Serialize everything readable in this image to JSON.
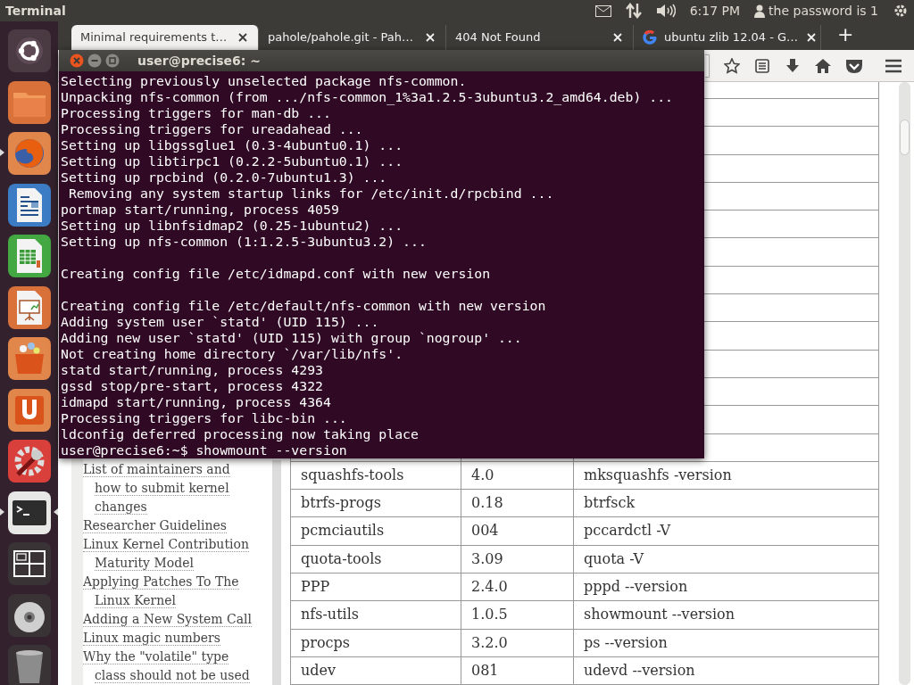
{
  "top_panel": {
    "app_title": "Terminal",
    "clock": "6:17 PM",
    "user": "the password is 1"
  },
  "launcher": [
    {
      "kind": "dash",
      "running": false,
      "focused": false
    },
    {
      "kind": "files",
      "running": false,
      "focused": false
    },
    {
      "kind": "firefox",
      "running": true,
      "focused": false
    },
    {
      "kind": "writer",
      "running": false,
      "focused": false
    },
    {
      "kind": "calc",
      "running": false,
      "focused": false
    },
    {
      "kind": "impress",
      "running": false,
      "focused": false
    },
    {
      "kind": "software",
      "running": false,
      "focused": false
    },
    {
      "kind": "ubuntuone",
      "running": false,
      "focused": false
    },
    {
      "kind": "settings",
      "running": false,
      "focused": false
    },
    {
      "kind": "terminal",
      "running": true,
      "focused": true
    },
    {
      "kind": "workspaces",
      "running": false,
      "focused": false
    },
    {
      "kind": "disc",
      "running": false,
      "focused": false
    },
    {
      "kind": "trash",
      "running": false,
      "focused": false
    }
  ],
  "browser": {
    "tabs": [
      {
        "title": "Minimal requirements t…",
        "selected": true,
        "favicon": false
      },
      {
        "title": "pahole/pahole.git - Pah…",
        "selected": false,
        "favicon": false
      },
      {
        "title": "404 Not Found",
        "selected": false,
        "favicon": false
      },
      {
        "title": "ubuntu zlib 12.04 - G…",
        "selected": false,
        "favicon": true
      }
    ],
    "new_tab": "+"
  },
  "sidebar": {
    "links": [
      "List of maintainers and how to submit kernel changes",
      "Researcher Guidelines",
      "Linux Kernel Contribution Maturity Model",
      "Applying Patches To The Linux Kernel",
      "Adding a New System Call",
      "Linux magic numbers",
      "Why the \"volatile\" type class should not be used"
    ]
  },
  "table": {
    "rows": [
      [
        "squashfs-tools",
        "4.0",
        "mksquashfs -version"
      ],
      [
        "btrfs-progs",
        "0.18",
        "btrfsck"
      ],
      [
        "pcmciautils",
        "004",
        "pccardctl -V"
      ],
      [
        "quota-tools",
        "3.09",
        "quota -V"
      ],
      [
        "PPP",
        "2.4.0",
        "pppd --version"
      ],
      [
        "nfs-utils",
        "1.0.5",
        "showmount --version"
      ],
      [
        "procps",
        "3.2.0",
        "ps --version"
      ],
      [
        "udev",
        "081",
        "udevd --version"
      ]
    ]
  },
  "terminal": {
    "title": "user@precise6: ~",
    "blocks": [
      [
        "Selecting previously unselected package nfs-common.",
        "Unpacking nfs-common (from .../nfs-common_1%3a1.2.5-3ubuntu3.2_amd64.deb) ...",
        "Processing triggers for man-db ...",
        "Processing triggers for ureadahead ...",
        "Setting up libgssglue1 (0.3-4ubuntu0.1) ...",
        "Setting up libtirpc1 (0.2.2-5ubuntu0.1) ...",
        "Setting up rpcbind (0.2.0-7ubuntu1.3) ...",
        " Removing any system startup links for /etc/init.d/rpcbind ...",
        "portmap start/running, process 4059",
        "Setting up libnfsidmap2 (0.25-1ubuntu2) ...",
        "Setting up nfs-common (1:1.2.5-3ubuntu3.2) ..."
      ],
      [
        "Creating config file /etc/idmapd.conf with new version"
      ],
      [
        "Creating config file /etc/default/nfs-common with new version",
        "Adding system user `statd' (UID 115) ...",
        "Adding new user `statd' (UID 115) with group `nogroup' ...",
        "Not creating home directory `/var/lib/nfs'.",
        "statd start/running, process 4293",
        "gssd stop/pre-start, process 4322",
        "idmapd start/running, process 4364",
        "Processing triggers for libc-bin ...",
        "ldconfig deferred processing now taking place",
        "user@precise6:~$ showmount --version"
      ]
    ]
  }
}
